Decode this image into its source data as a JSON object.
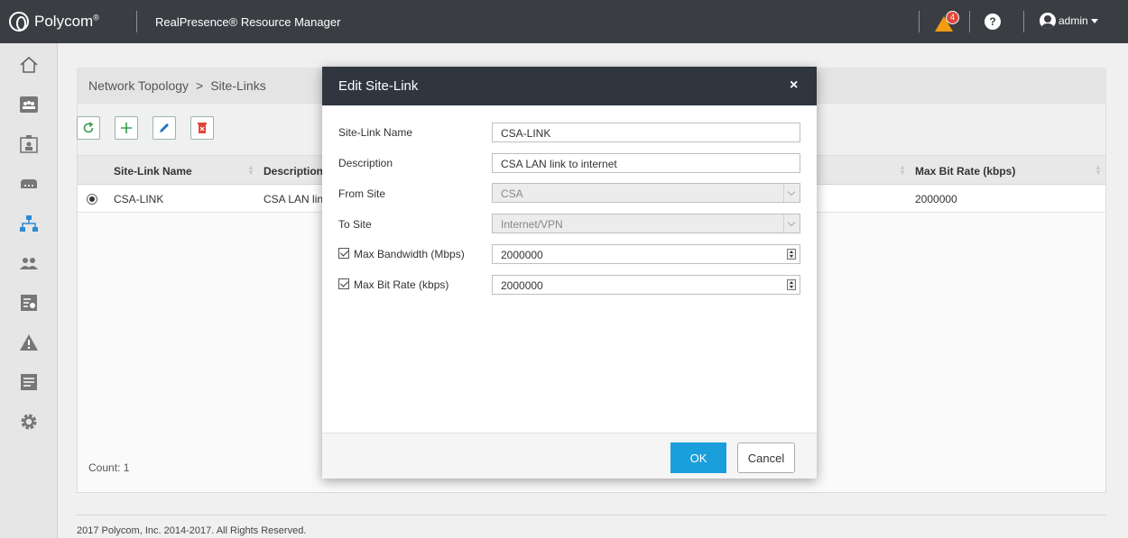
{
  "header": {
    "brand": "Polycom",
    "brand_mark": "®",
    "app_title": "RealPresence® Resource Manager",
    "alert_count": "4",
    "help_glyph": "?",
    "user": "admin",
    "bg_color": "#3a3e43"
  },
  "sidebar": {
    "items": [
      {
        "icon": "home-icon"
      },
      {
        "icon": "conference-icon"
      },
      {
        "icon": "endpoint-icon"
      },
      {
        "icon": "network-device-icon"
      },
      {
        "icon": "network-topology-icon"
      },
      {
        "icon": "users-icon"
      },
      {
        "icon": "reports-icon"
      },
      {
        "icon": "alerts-icon"
      },
      {
        "icon": "logs-icon"
      },
      {
        "icon": "settings-icon"
      }
    ]
  },
  "breadcrumb": {
    "parent": "Network Topology",
    "separator": ">",
    "current": "Site-Links"
  },
  "toolbar": {
    "buttons": [
      {
        "icon": "refresh-icon"
      },
      {
        "icon": "add-icon"
      },
      {
        "icon": "edit-icon"
      },
      {
        "icon": "delete-icon"
      }
    ]
  },
  "grid": {
    "columns": [
      "Site-Link Name",
      "Description",
      "Max Bit Rate (kbps)"
    ],
    "rows": [
      {
        "name": "CSA-LINK",
        "description": "CSA LAN link to internet",
        "max_bit_rate": "2000000",
        "selected": true
      }
    ],
    "count_label": "Count: 1"
  },
  "modal": {
    "title": "Edit Site-Link",
    "close_glyph": "×",
    "fields": {
      "name_label": "Site-Link Name",
      "name_value": "CSA-LINK",
      "description_label": "Description",
      "description_value": "CSA LAN link to internet",
      "from_site_label": "From Site",
      "from_site_value": "CSA",
      "to_site_label": "To Site",
      "to_site_value": "Internet/VPN",
      "max_bandwidth_label": "Max Bandwidth (Mbps)",
      "max_bandwidth_value": "2000000",
      "max_bandwidth_checked": true,
      "max_bit_rate_label": "Max Bit Rate (kbps)",
      "max_bit_rate_value": "2000000",
      "max_bit_rate_checked": true
    },
    "ok_label": "OK",
    "cancel_label": "Cancel",
    "ok_color": "#1a9fdb"
  },
  "footer": {
    "copyright": "2017 Polycom, Inc. 2014-2017. All Rights Reserved."
  }
}
